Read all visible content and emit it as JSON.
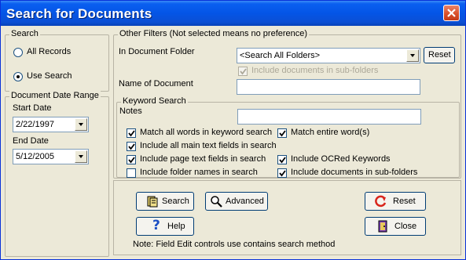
{
  "window": {
    "title": "Search for Documents"
  },
  "search_group": {
    "legend": "Search",
    "all_records": "All Records",
    "use_search": "Use Search",
    "selected": "use_search"
  },
  "date_range": {
    "legend": "Document Date Range",
    "start_label": "Start Date",
    "start_value": "2/22/1997",
    "end_label": "End Date",
    "end_value": "5/12/2005"
  },
  "other_filters": {
    "legend": "Other Filters (Not selected means no preference)",
    "folder_label": "In Document Folder",
    "folder_value": "<Search All Folders>",
    "reset_label": "Reset",
    "include_subfolders": "Include documents in sub-folders",
    "name_label": "Name of Document",
    "name_value": ""
  },
  "keyword_search": {
    "legend": "Keyword Search",
    "notes_label": "Notes",
    "notes_value": "",
    "options": {
      "match_all": {
        "label": "Match all words in keyword search",
        "checked": true
      },
      "match_entire": {
        "label": "Match entire word(s)",
        "checked": true
      },
      "include_main_text": {
        "label": "Include all main text fields in search",
        "checked": true
      },
      "include_page_text": {
        "label": "Include page text fields in search",
        "checked": true
      },
      "include_ocr": {
        "label": "Include OCRed Keywords",
        "checked": true
      },
      "include_folder_names": {
        "label": "Include folder names in search",
        "checked": false
      },
      "include_subfolders": {
        "label": "Include documents in sub-folders",
        "checked": true
      }
    }
  },
  "buttons": {
    "search": "Search",
    "advanced": "Advanced",
    "reset": "Reset",
    "help": "Help",
    "close": "Close"
  },
  "note": "Note: Field Edit controls use contains search method",
  "colors": {
    "title_bar": "#0455e6",
    "close_button": "#d9512a",
    "dialog_bg": "#ece9d8"
  }
}
